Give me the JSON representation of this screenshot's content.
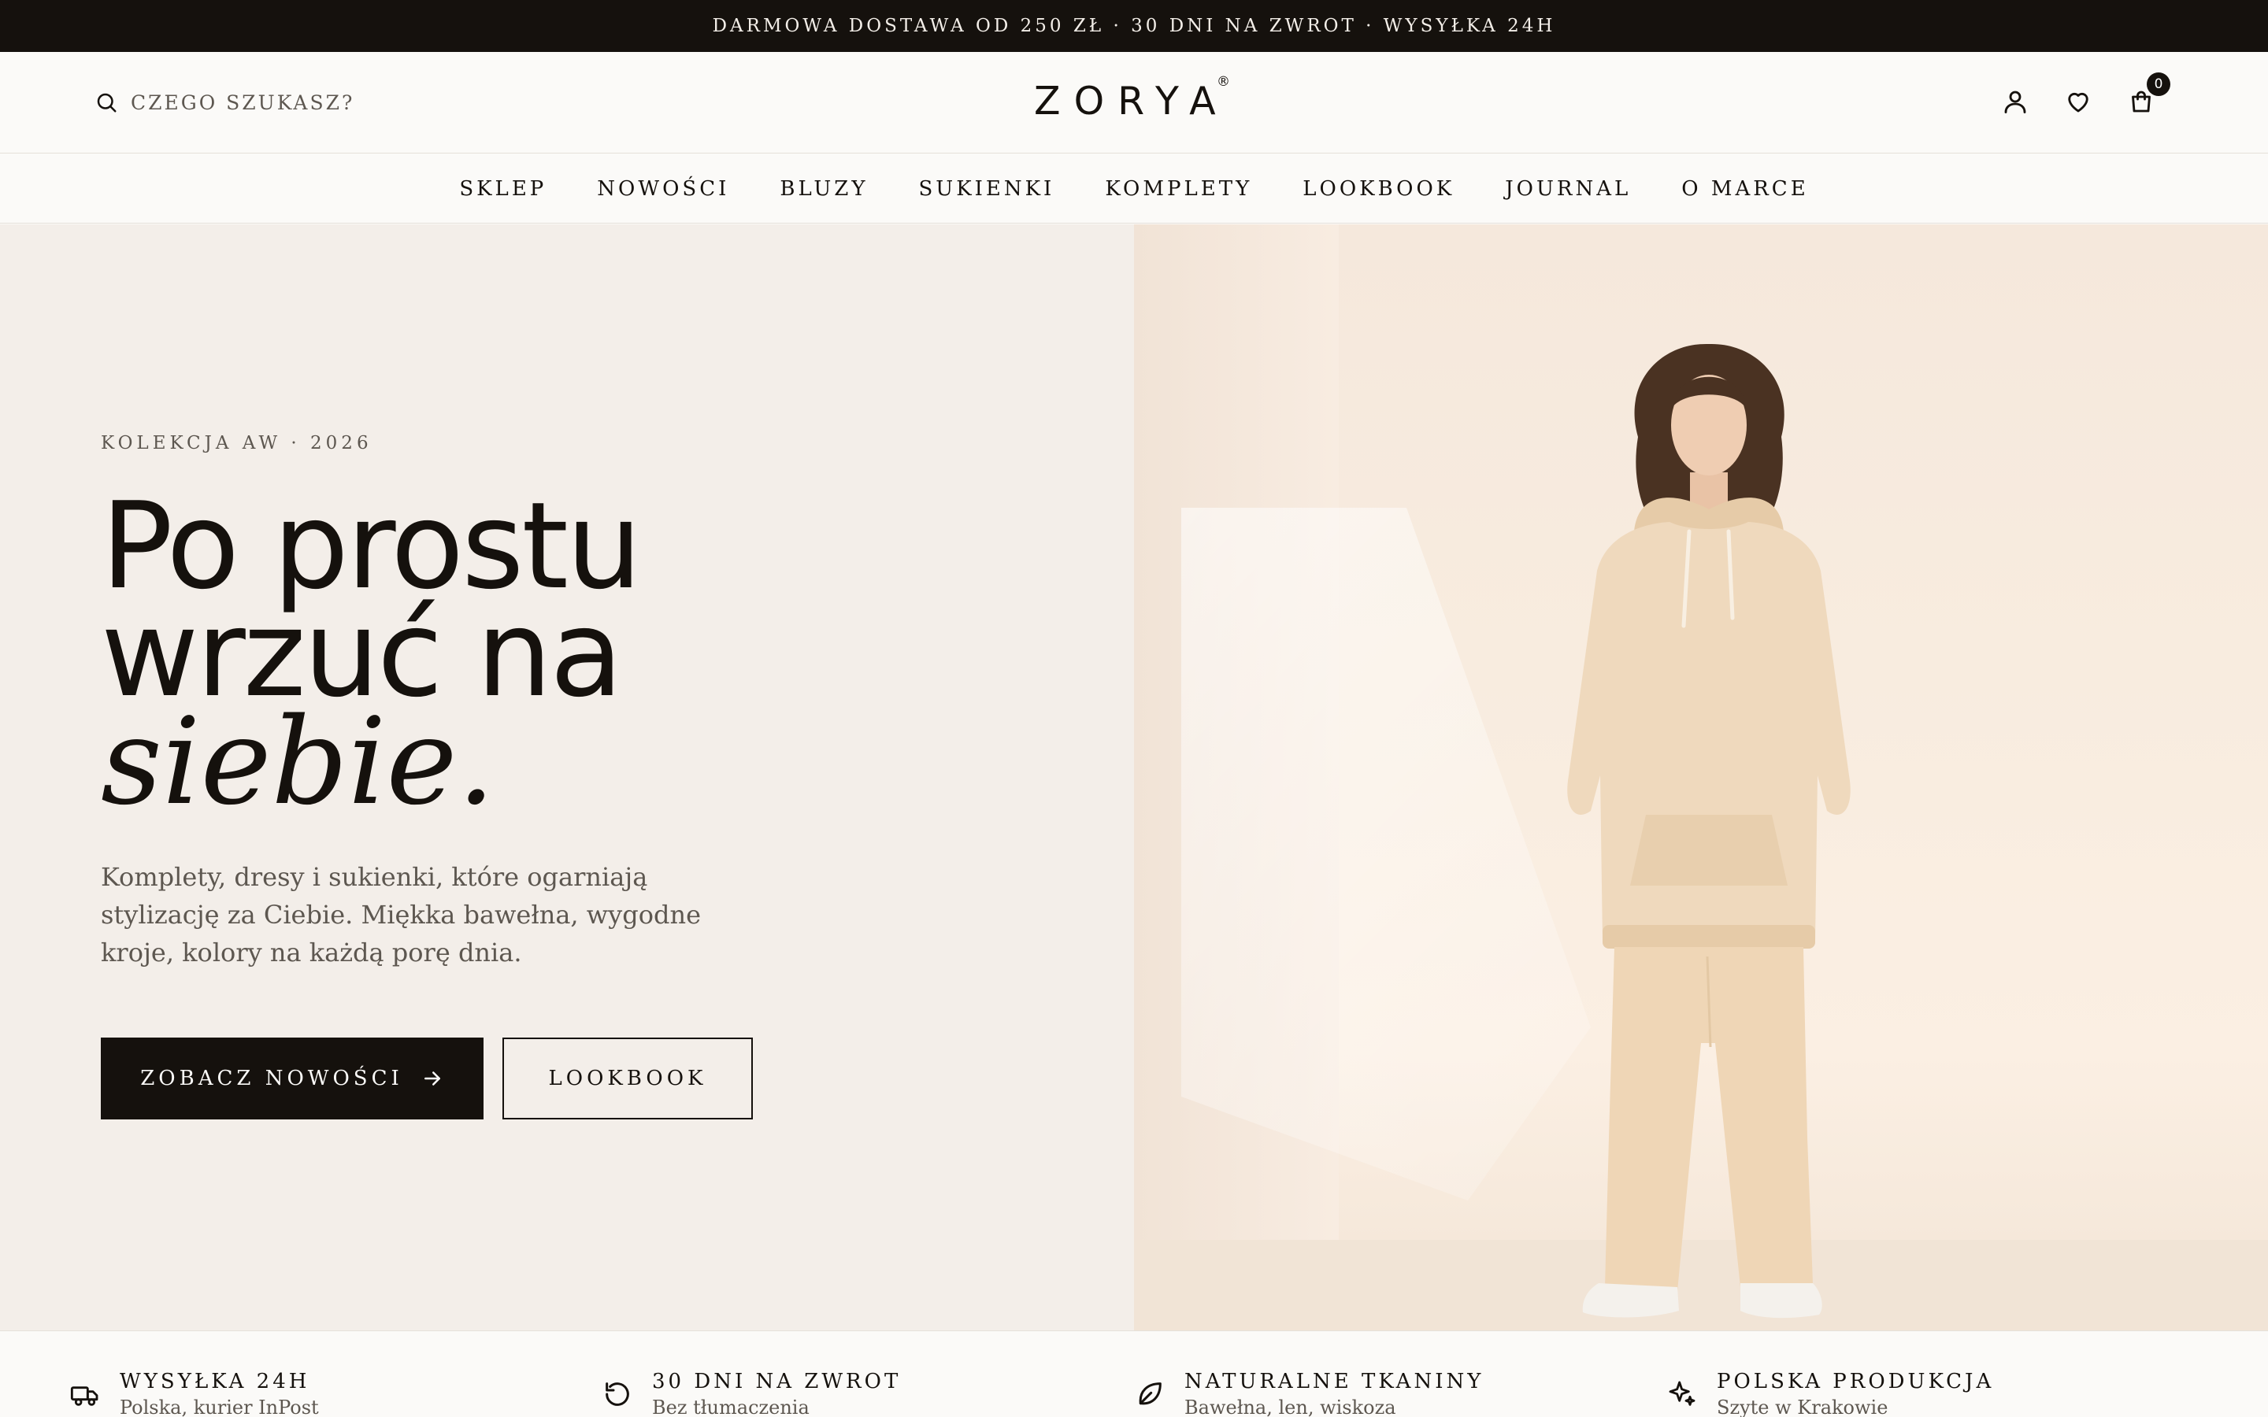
{
  "promo": {
    "text": "DARMOWA DOSTAWA OD 250 ZŁ · 30 DNI NA ZWROT · WYSYŁKA 24H"
  },
  "header": {
    "search_label": "CZEGO SZUKASZ?",
    "logo": "ZORYA",
    "logo_mark": "®",
    "cart_count": "0",
    "icons": [
      "search-icon",
      "user-icon",
      "heart-icon",
      "shopping-bag-icon"
    ]
  },
  "nav": {
    "items": [
      "SKLEP",
      "NOWOŚCI",
      "BLUZY",
      "SUKIENKI",
      "KOMPLETY",
      "LOOKBOOK",
      "JOURNAL",
      "O MARCE"
    ]
  },
  "hero": {
    "eyebrow": "KOLEKCJA AW · 2026",
    "headline_line1": "Po prostu",
    "headline_line2": "wrzuć na",
    "headline_line3": "siebie.",
    "lede": "Komplety, dresy i sukienki, które ogarniają stylizację za Ciebie. Miękka bawełna, wygodne kroje, kolory na każdą porę dnia.",
    "primary_cta": "ZOBACZ NOWOŚCI",
    "secondary_cta": "LOOKBOOK"
  },
  "usps": [
    {
      "icon": "truck-icon",
      "title": "WYSYŁKA 24H",
      "subtitle": "Polska, kurier InPost"
    },
    {
      "icon": "return-icon",
      "title": "30 DNI NA ZWROT",
      "subtitle": "Bez tłumaczenia"
    },
    {
      "icon": "leaf-icon",
      "title": "NATURALNE TKANINY",
      "subtitle": "Bawełna, len, wiskoza"
    },
    {
      "icon": "sparkle-icon",
      "title": "POLSKA PRODUKCJA",
      "subtitle": "Szyte w Krakowie"
    }
  ],
  "colors": {
    "ink": "#15110d",
    "paper": "#fbfaf8",
    "hero_bg": "#f3eee9",
    "muted": "#5d5750",
    "product_beige": "#efd9bd"
  }
}
